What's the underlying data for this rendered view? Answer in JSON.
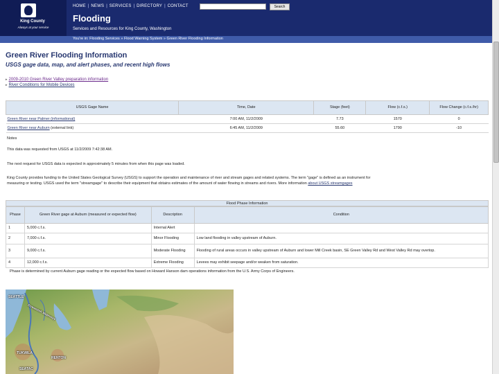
{
  "header": {
    "logo_name": "King County",
    "logo_tagline": "Always at your service",
    "nav": [
      "HOME",
      "NEWS",
      "SERVICES",
      "DIRECTORY",
      "CONTACT"
    ],
    "search_value": "",
    "search_button": "Search",
    "site_title": "Flooding",
    "site_subtitle": "Services and Resources for King County, Washington"
  },
  "breadcrumb": {
    "prefix": "You're in:",
    "items": [
      "Flooding Services",
      "Flood Warning System",
      "Green River Flooding Information"
    ],
    "separator": "»"
  },
  "page": {
    "title": "Green River Flooding Information",
    "subtitle": "USGS gage data, map, and alert phases, and recent high flows",
    "links": [
      "2009-2010 Green River Valley preparation information",
      "River Conditions for Mobile Devices"
    ]
  },
  "gage_table": {
    "headers": [
      "USGS Gage Name",
      "Time, Date",
      "Stage (feet)",
      "Flow (c.f.s.)",
      "Flow Change (c.f.s./hr)"
    ],
    "rows": [
      {
        "name": "Green River near Palmer (informational)",
        "time": "7:00 AM, 11/2/2009",
        "stage": "7.73",
        "flow": "1570",
        "change": "0"
      },
      {
        "name": "Green River near Auburn",
        "name_extra": " (external link)",
        "time": "6:45 AM, 11/2/2009",
        "stage": "55.60",
        "flow": "1790",
        "change": "-10"
      }
    ]
  },
  "notes": {
    "label": "Notes",
    "requested": "This data was requested from USGS at 11/2/2009 7:42:38 AM.",
    "next_request": "The next request for USGS data is expected in approximately 5 minutes from when this page was loaded.",
    "funding_1": "King County provides funding to the United States Geological Survey (USGS) to support the operation and maintenance of river and stream gages and related systems. The term \"gage\" is defined as an instrument for",
    "funding_2": "measuring or testing. USGS used the term \"streamgage\" to describe their equipment that obtains estimates of the amount of water flowing in streams and rivers. More information",
    "funding_link": "about USGS streamgages"
  },
  "flood_table": {
    "title": "Flood Phase Information",
    "headers": [
      "Phase",
      "Green River gage at Auburn (measured or expected flow)",
      "Description",
      "Condition"
    ],
    "rows": [
      {
        "phase": "1",
        "flow": "5,000 c.f.s.",
        "description": "Internal Alert",
        "condition": ""
      },
      {
        "phase": "2",
        "flow": "7,000 c.f.s.",
        "description": "Minor Flooding",
        "condition": "Low land flooding in valley upstream of Auburn."
      },
      {
        "phase": "3",
        "flow": "9,000 c.f.s.",
        "description": "Moderate Flooding",
        "condition": "Flooding of rural areas occurs in valley upstream of Auburn and lower Mill Creek basin, SE Green Valley Rd and West Valley Rd may overtop."
      },
      {
        "phase": "4",
        "flow": "12,000 c.f.s.",
        "description": "Extreme Flooding",
        "condition": "Levees may exhibit seepage and/or weaken from saturation."
      }
    ],
    "footnote": "Phase is determined by current Auburn gage reading or the expected flow based on Howard Hanson dam operations information from the U.S. Army Corps of Engineers."
  },
  "map": {
    "labels": [
      "SEATTLE",
      "Duwamish Waterway",
      "TUKWILA",
      "RENTON",
      "SEATAC"
    ]
  }
}
